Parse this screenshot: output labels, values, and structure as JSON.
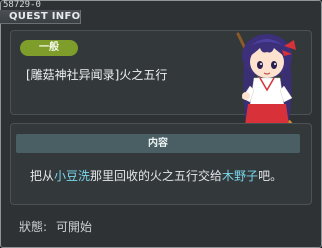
{
  "quest_id": "58729-0",
  "window_title": "QUEST INFO",
  "category_badge": "一般",
  "quest_name": "[雕菇神社异闻录]火之五行",
  "content_header": "内容",
  "description": {
    "part1": "把从",
    "npc1": "小豆洗",
    "part2": "那里回收的火之五行交给",
    "npc2": "木野子",
    "part3": "吧。"
  },
  "status": {
    "label": "狀態:",
    "value": "可開始"
  },
  "colors": {
    "badge": "#7e9d2a",
    "highlight": "#79d8ec",
    "content_header": "#495f63"
  },
  "npc_portrait": "shrine-maiden-with-broom"
}
